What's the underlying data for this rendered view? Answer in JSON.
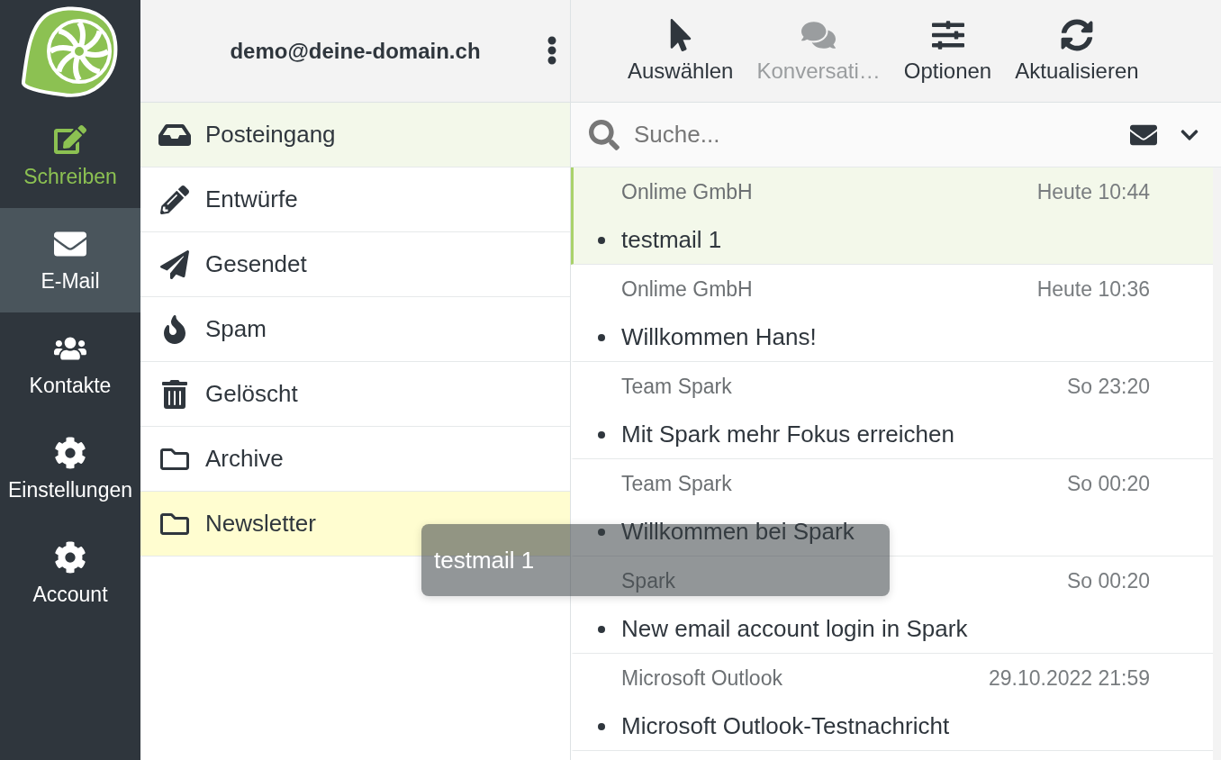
{
  "nav": [
    {
      "label": "Schreiben",
      "kind": "compose",
      "selected": false
    },
    {
      "label": "E-Mail",
      "kind": "item",
      "selected": true
    },
    {
      "label": "Kontakte",
      "kind": "item",
      "selected": false
    },
    {
      "label": "Einstellungen",
      "kind": "item",
      "selected": false
    },
    {
      "label": "Account",
      "kind": "item",
      "selected": false
    }
  ],
  "account": {
    "email": "demo@deine-domain.ch"
  },
  "toolbar": [
    {
      "label": "Auswählen",
      "disabled": false
    },
    {
      "label": "Konversati…",
      "disabled": true
    },
    {
      "label": "Optionen",
      "disabled": false
    },
    {
      "label": "Aktualisieren",
      "disabled": false
    }
  ],
  "folders": [
    {
      "label": "Posteingang",
      "selected": true,
      "highlighted": false
    },
    {
      "label": "Entwürfe",
      "selected": false,
      "highlighted": false
    },
    {
      "label": "Gesendet",
      "selected": false,
      "highlighted": false
    },
    {
      "label": "Spam",
      "selected": false,
      "highlighted": false
    },
    {
      "label": "Gelöscht",
      "selected": false,
      "highlighted": false
    },
    {
      "label": "Archive",
      "selected": false,
      "highlighted": false
    },
    {
      "label": "Newsletter",
      "selected": false,
      "highlighted": true
    }
  ],
  "search": {
    "placeholder": "Suche..."
  },
  "messages": [
    {
      "sender": "Onlime GmbH",
      "date": "Heute 10:44",
      "subject": "testmail 1",
      "selected": true,
      "unread": true
    },
    {
      "sender": "Onlime GmbH",
      "date": "Heute 10:36",
      "subject": "Willkommen Hans!",
      "selected": false,
      "unread": true
    },
    {
      "sender": "Team Spark",
      "date": "So 23:20",
      "subject": "Mit Spark mehr Fokus erreichen",
      "selected": false,
      "unread": true
    },
    {
      "sender": "Team Spark",
      "date": "So 00:20",
      "subject": "Willkommen bei Spark",
      "selected": false,
      "unread": true
    },
    {
      "sender": "Spark",
      "date": "So 00:20",
      "subject": "New email account login in Spark",
      "selected": false,
      "unread": true
    },
    {
      "sender": "Microsoft Outlook",
      "date": "29.10.2022 21:59",
      "subject": "Microsoft Outlook-Testnachricht",
      "selected": false,
      "unread": true
    }
  ],
  "drag_preview": {
    "label": "testmail 1"
  }
}
